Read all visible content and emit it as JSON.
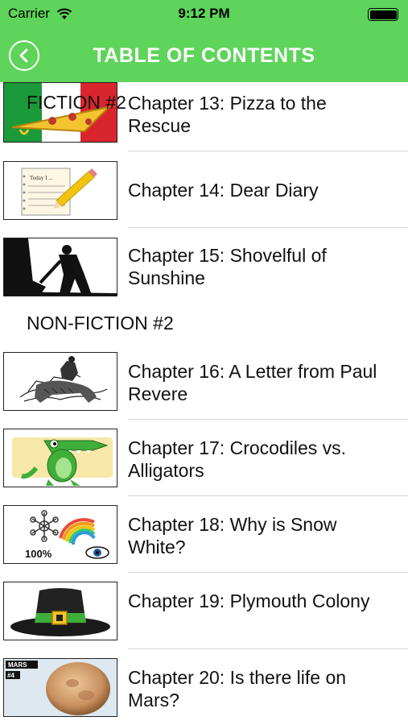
{
  "status_bar": {
    "carrier": "Carrier",
    "time": "9:12 PM"
  },
  "nav": {
    "title": "TABLE OF CONTENTS"
  },
  "sections": [
    {
      "header": "FICTION #2"
    },
    {
      "header": "NON-FICTION #2"
    }
  ],
  "chapters": [
    {
      "title": "Chapter 13: Pizza to the Rescue",
      "icon": "pizza-flag-icon"
    },
    {
      "title": "Chapter 14: Dear Diary",
      "icon": "diary-pencil-icon",
      "thumb_text": "Today I ..."
    },
    {
      "title": "Chapter 15: Shovelful of Sunshine",
      "icon": "shoveling-silhouette-icon"
    },
    {
      "title": "Chapter 16: A Letter from Paul Revere",
      "icon": "horse-rider-icon"
    },
    {
      "title": "Chapter 17: Crocodiles vs. Alligators",
      "icon": "crocodile-icon"
    },
    {
      "title": "Chapter 18: Why is Snow White?",
      "icon": "snowflake-rainbow-icon",
      "thumb_text": "100%"
    },
    {
      "title": "Chapter 19: Plymouth Colony",
      "icon": "pilgrim-hat-icon"
    },
    {
      "title": "Chapter 20: Is there life on Mars?",
      "icon": "mars-planet-icon",
      "thumb_text": "MARS",
      "thumb_sub": "#4"
    }
  ],
  "colors": {
    "accent": "#5ed45a",
    "separator": "#d8d8d8"
  }
}
